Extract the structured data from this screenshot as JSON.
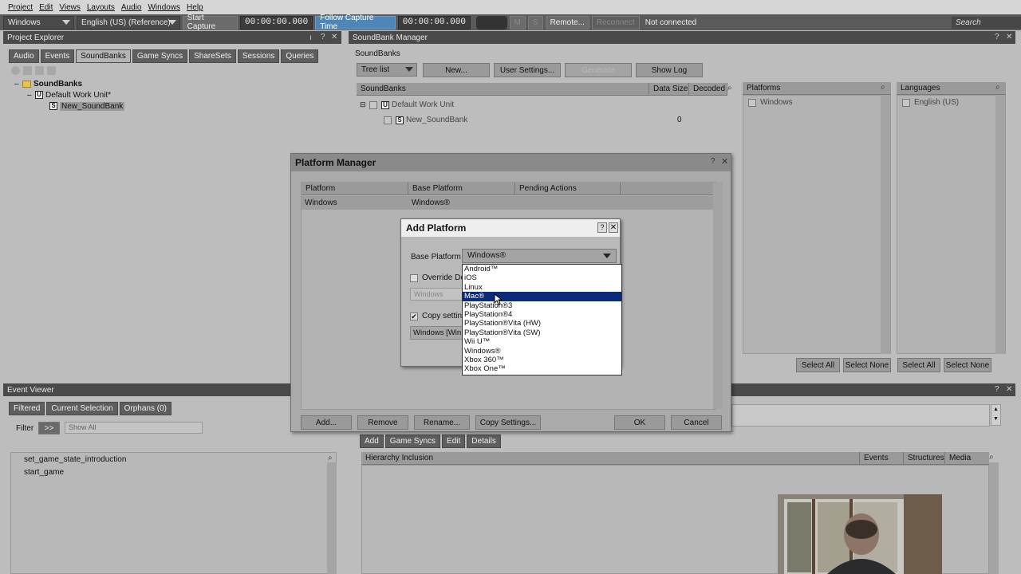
{
  "menu": [
    "Project",
    "Edit",
    "Views",
    "Layouts",
    "Audio",
    "Windows",
    "Help"
  ],
  "toolbar": {
    "platform": "Windows",
    "language": "English (US) (Reference)",
    "start_capture": "Start Capture",
    "time1": "00:00:00.000",
    "follow_capture": "Follow Capture Time",
    "time2": "00:00:00.000",
    "m": "M",
    "s": "S",
    "remote": "Remote...",
    "reconnect": "Reconnect",
    "status": "Not connected",
    "search": "Search"
  },
  "project_explorer": {
    "title": "Project Explorer",
    "tabs": [
      "Audio",
      "Events",
      "SoundBanks",
      "Game Syncs",
      "ShareSets",
      "Sessions",
      "Queries"
    ],
    "tree": [
      "SoundBanks",
      "Default Work Unit*",
      "New_SoundBank"
    ]
  },
  "soundbank_manager": {
    "title": "SoundBank Manager",
    "section": "SoundBanks",
    "view": "Tree list",
    "buttons": [
      "New...",
      "User Settings...",
      "Generate",
      "Show Log"
    ],
    "columns": [
      "SoundBanks",
      "Data Size",
      "Decoded"
    ],
    "rows": [
      {
        "name": "Default Work Unit",
        "size": ""
      },
      {
        "name": "New_SoundBank",
        "size": "0"
      }
    ],
    "platforms_header": "Platforms",
    "platforms": [
      "Windows"
    ],
    "languages_header": "Languages",
    "languages": [
      "English (US)"
    ],
    "select_all": "Select All",
    "select_none": "Select None"
  },
  "event_viewer": {
    "title": "Event Viewer",
    "tabs": [
      "Filtered",
      "Current Selection",
      "Orphans (0)"
    ],
    "filter_label": "Filter",
    "filter_btn": ">>",
    "filter_value": "Show All",
    "events": [
      "set_game_state_introduction",
      "start_game"
    ]
  },
  "bottom_panel": {
    "tabs": [
      "Add",
      "Game Syncs",
      "Edit",
      "Details"
    ],
    "columns": [
      "Hierarchy Inclusion",
      "Events",
      "Structures",
      "Media"
    ]
  },
  "platform_manager": {
    "title": "Platform Manager",
    "columns": [
      "Platform",
      "Base Platform",
      "Pending Actions"
    ],
    "row": {
      "platform": "Windows",
      "base": "Windows®"
    },
    "buttons": [
      "Add...",
      "Remove",
      "Rename...",
      "Copy Settings...",
      "OK",
      "Cancel"
    ]
  },
  "add_platform": {
    "title": "Add Platform",
    "base_label": "Base Platform",
    "base_value": "Windows®",
    "override_label": "Override De",
    "name_placeholder": "Windows",
    "copy_label": "Copy setting",
    "copy_value": "Windows [Win",
    "options": [
      "Android™",
      "iOS",
      "Linux",
      "Mac®",
      "PlayStation®3",
      "PlayStation®4",
      "PlayStation®Vita (HW)",
      "PlayStation®Vita (SW)",
      "Wii U™",
      "Windows®",
      "Xbox 360™",
      "Xbox One™"
    ],
    "highlighted": "Mac®"
  }
}
